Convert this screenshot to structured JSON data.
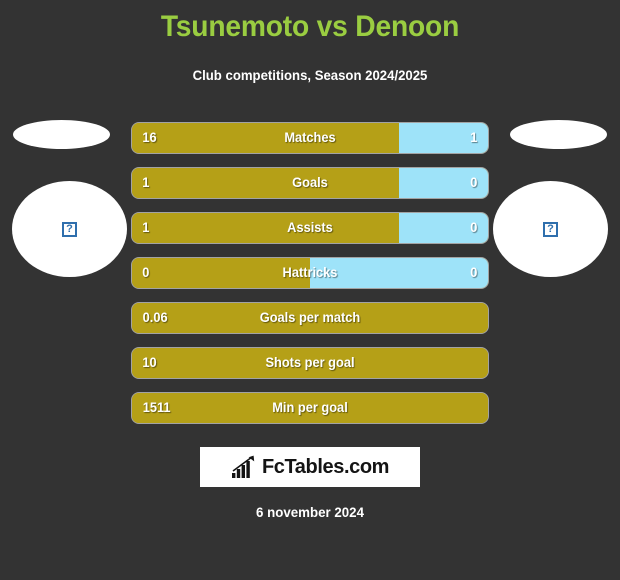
{
  "header": {
    "title": "Tsunemoto vs Denoon",
    "subtitle": "Club competitions, Season 2024/2025",
    "title_color": "#9ACD41",
    "subtitle_color": "#ffffff"
  },
  "sides": {
    "left": {
      "name_placeholder": "",
      "crest_icon": "broken-image-icon",
      "crest_glyph": "?"
    },
    "right": {
      "name_placeholder": "",
      "crest_icon": "broken-image-icon",
      "crest_glyph": "?"
    }
  },
  "footer": {
    "logo_icon": "bar-chart-arrow-icon",
    "logo_text": "FcTables.com",
    "date": "6 november 2024"
  },
  "colors": {
    "background": "#333333",
    "home_bar": "#B5A017",
    "away_bar": "#9EE3F9",
    "title": "#9ACD41",
    "text": "#ffffff"
  },
  "chart_data": {
    "type": "bar",
    "title": "Tsunemoto vs Denoon",
    "subtitle": "Club competitions, Season 2024/2025",
    "orientation": "horizontal-diverging",
    "legend_position": "none",
    "grid": false,
    "xlabel": "",
    "ylabel": "",
    "series": [
      {
        "name": "Tsunemoto",
        "color": "#B5A017",
        "values": [
          "16",
          "1",
          "1",
          "0",
          "0.06",
          "10",
          "1511"
        ]
      },
      {
        "name": "Denoon",
        "color": "#9EE3F9",
        "values": [
          "1",
          "0",
          "0",
          "0",
          null,
          null,
          null
        ]
      }
    ],
    "categories": [
      "Matches",
      "Goals",
      "Assists",
      "Hattricks",
      "Goals per match",
      "Shots per goal",
      "Min per goal"
    ],
    "rows": [
      {
        "label": "Matches",
        "home_value": "16",
        "away_value": "1",
        "home_pct": 75,
        "away_pct": 25,
        "has_away": true
      },
      {
        "label": "Goals",
        "home_value": "1",
        "away_value": "0",
        "home_pct": 75,
        "away_pct": 25,
        "has_away": true
      },
      {
        "label": "Assists",
        "home_value": "1",
        "away_value": "0",
        "home_pct": 75,
        "away_pct": 25,
        "has_away": true
      },
      {
        "label": "Hattricks",
        "home_value": "0",
        "away_value": "0",
        "home_pct": 50,
        "away_pct": 50,
        "has_away": true
      },
      {
        "label": "Goals per match",
        "home_value": "0.06",
        "away_value": "",
        "home_pct": 100,
        "away_pct": 0,
        "has_away": false
      },
      {
        "label": "Shots per goal",
        "home_value": "10",
        "away_value": "",
        "home_pct": 100,
        "away_pct": 0,
        "has_away": false
      },
      {
        "label": "Min per goal",
        "home_value": "1511",
        "away_value": "",
        "home_pct": 100,
        "away_pct": 0,
        "has_away": false
      }
    ]
  }
}
